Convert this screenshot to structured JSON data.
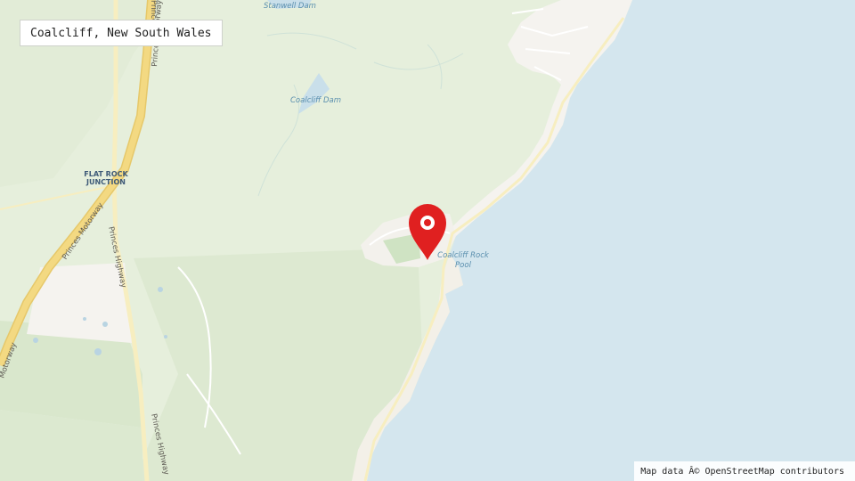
{
  "place": {
    "name": "Coalcliff, New South Wales"
  },
  "attribution": "Map data Â© OpenStreetMap contributors",
  "labels": {
    "stanwell_dam": "Stanwell Dam",
    "coalcliff_dam": "Coalcliff Dam",
    "flat_rock_line1": "FLAT ROCK",
    "flat_rock_line2": "JUNCTION",
    "rock_pool_line1": "Coalcliff Rock",
    "rock_pool_line2": "Pool",
    "princes_motorway": "Princes Motorway",
    "princes_motorway_top": "Princes Motorway",
    "motorway_edge": "Motorway",
    "princes_highway": "Princes Highway",
    "princes_highway_south": "Princes Highway",
    "princes_top": "Princes"
  },
  "colors": {
    "sea": "#d4e6ee",
    "land": "#e6efdc",
    "forest": "#dfebd3",
    "urban": "#f5f3ef",
    "motorway": "#f3d982",
    "highway": "#f7eec0",
    "marker": "#e02020"
  },
  "icons": {
    "marker": "map-pin-icon"
  }
}
